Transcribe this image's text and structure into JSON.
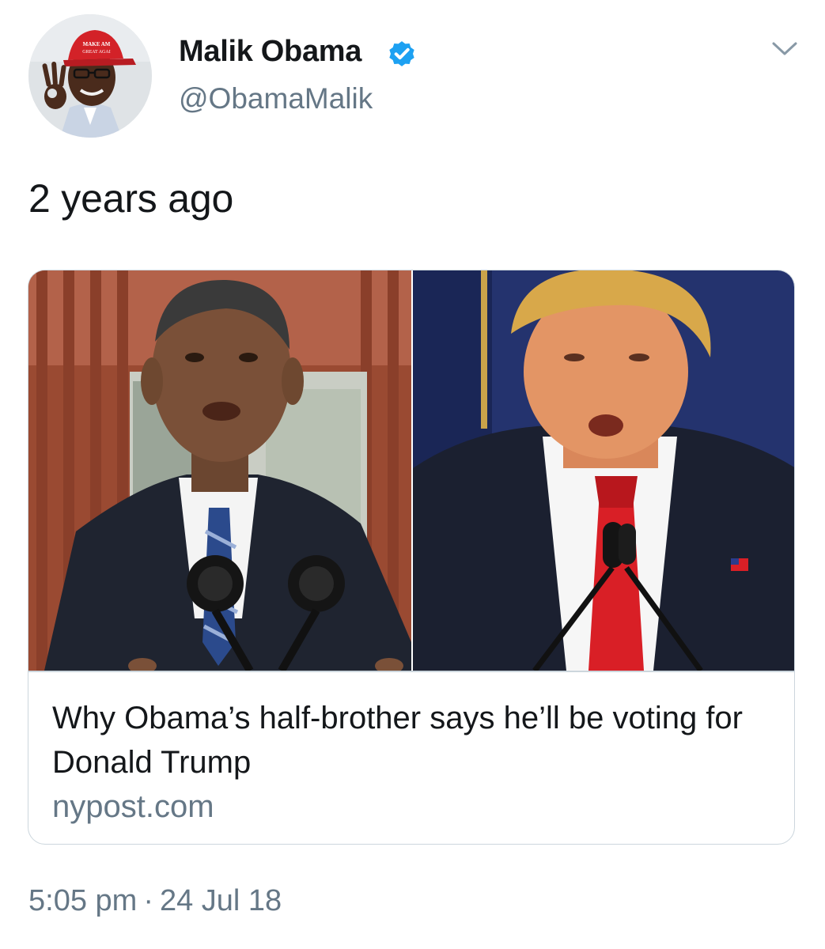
{
  "author": {
    "display_name": "Malik Obama",
    "handle": "@ObamaMalik",
    "verified": true,
    "avatar_hat_text": "MAKE AMERICA GREAT AGAIN"
  },
  "tweet": {
    "text": "2 years ago"
  },
  "card": {
    "title": "Why Obama’s half-brother says he’ll be voting for Donald Trump",
    "domain": "nypost.com"
  },
  "meta": {
    "time": "5:05 pm",
    "separator": "·",
    "date": "24 Jul 18"
  },
  "icons": {
    "verified": "verified-badge-icon",
    "caret": "chevron-down-icon"
  },
  "colors": {
    "text_primary": "#14171a",
    "text_secondary": "#657786",
    "verified_blue": "#1da1f2",
    "card_border": "#ccd6dd"
  }
}
